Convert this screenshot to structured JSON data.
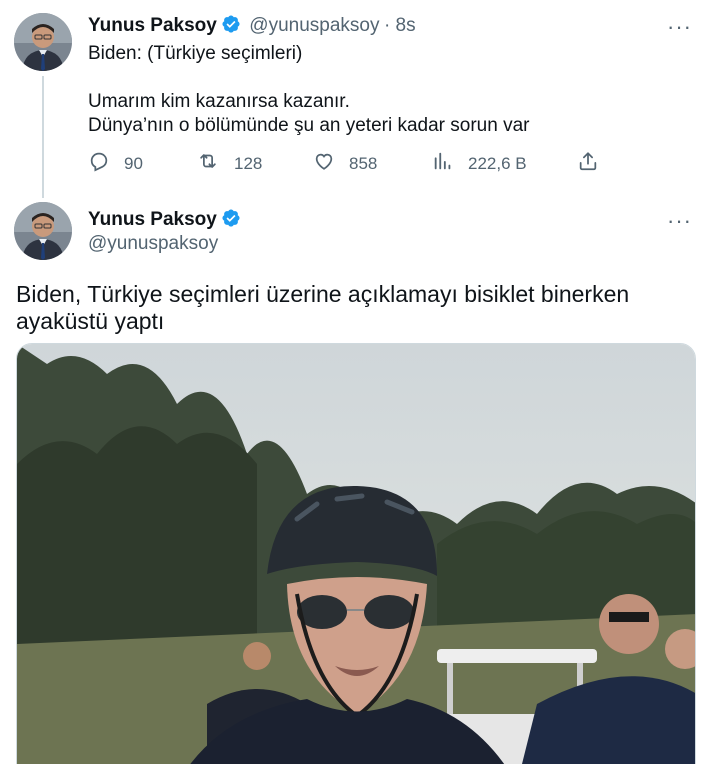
{
  "tweet1": {
    "author_name": "Yunus Paksoy",
    "handle": "@yunuspaksoy",
    "time": "· 8s",
    "lines": [
      "Biden: (Türkiye seçimleri)",
      "",
      "Umarım kim kazanırsa kazanır.",
      "Dünya’nın o bölümünde şu an yeteri kadar sorun var"
    ],
    "more_label": "···",
    "stats": {
      "replies": "90",
      "retweets": "128",
      "likes": "858",
      "views": "222,6 B"
    }
  },
  "tweet2": {
    "author_name": "Yunus Paksoy",
    "handle": "@yunuspaksoy",
    "more_label": "···",
    "text": "Biden, Türkiye seçimleri üzerine açıklamayı bisiklet binerken ayaküstü yaptı"
  },
  "colors": {
    "verified": "#1d9bf0",
    "muted": "#536471",
    "text": "#0f1419",
    "thread_line": "#cfd9de"
  },
  "icons": {
    "verified": "verified-badge-icon",
    "reply": "reply-icon",
    "retweet": "retweet-icon",
    "like": "heart-icon",
    "views": "views-icon",
    "share": "share-icon",
    "more": "more-icon"
  }
}
